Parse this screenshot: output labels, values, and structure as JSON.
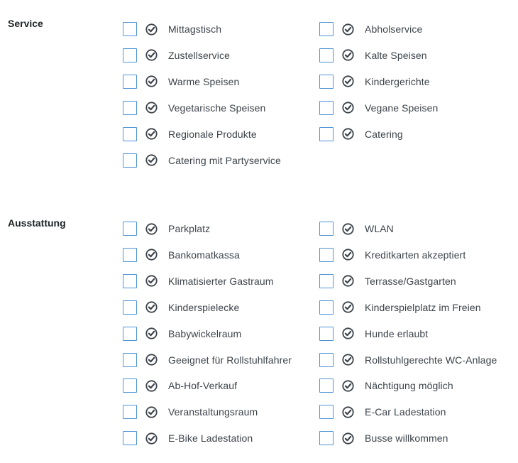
{
  "sections": [
    {
      "title": "Service",
      "items": [
        [
          "Mittagstisch",
          "Abholservice"
        ],
        [
          "Zustellservice",
          "Kalte Speisen"
        ],
        [
          "Warme Speisen",
          "Kindergerichte"
        ],
        [
          "Vegetarische Speisen",
          "Vegane Speisen"
        ],
        [
          "Regionale Produkte",
          "Catering"
        ],
        [
          "Catering mit Partyservice",
          null
        ]
      ]
    },
    {
      "title": "Ausstattung",
      "items": [
        [
          "Parkplatz",
          "WLAN"
        ],
        [
          "Bankomatkassa",
          "Kreditkarten akzeptiert"
        ],
        [
          "Klimatisierter Gastraum",
          "Terrasse/Gastgarten"
        ],
        [
          "Kinderspielecke",
          "Kinderspielplatz im Freien"
        ],
        [
          "Babywickelraum",
          "Hunde erlaubt"
        ],
        [
          "Geeignet für Rollstuhlfahrer",
          "Rollstuhlgerechte WC-Anlage"
        ],
        [
          "Ab-Hof-Verkauf",
          "Nächtigung möglich"
        ],
        [
          "Veranstaltungsraum",
          "E-Car Ladestation"
        ],
        [
          "E-Bike Ladestation",
          "Busse willkommen"
        ]
      ]
    }
  ],
  "icons": {
    "check": "check-circle-icon"
  },
  "colors": {
    "checkbox_border": "#4f94d4",
    "icon": "#3c434a",
    "text": "#3c434a",
    "heading": "#1d2327"
  }
}
